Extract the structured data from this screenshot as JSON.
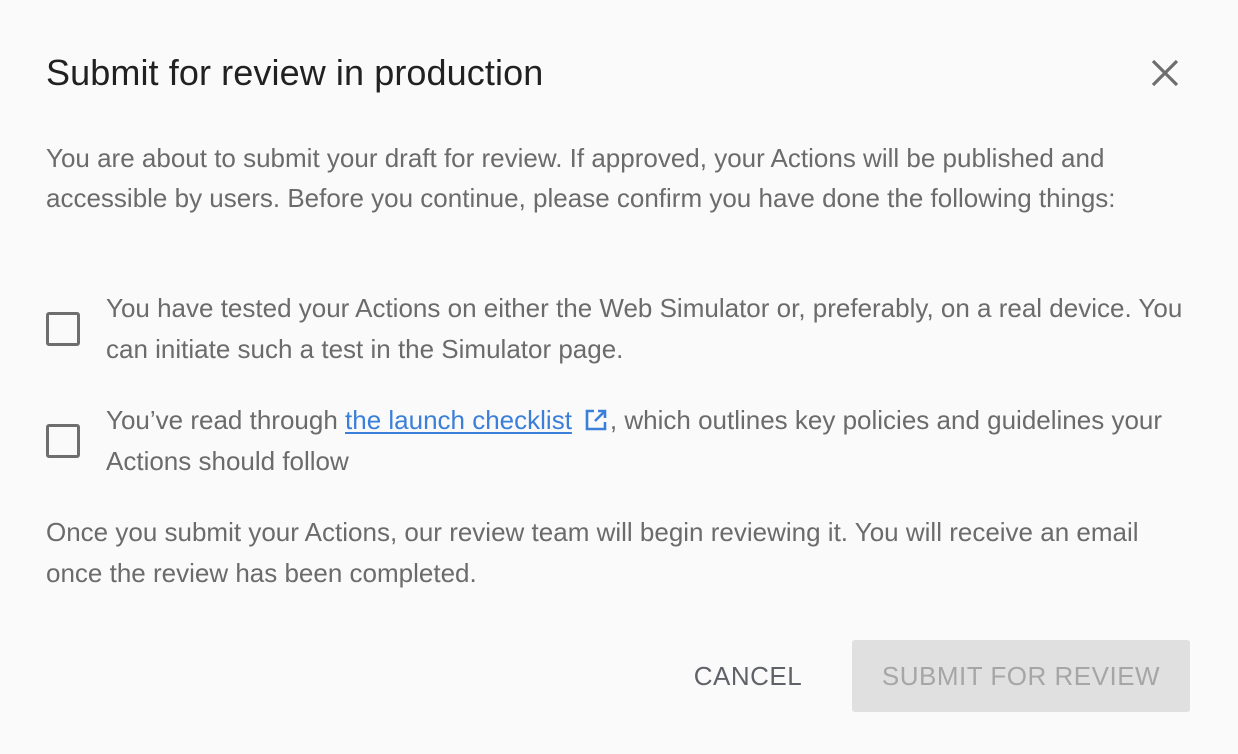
{
  "dialog": {
    "title": "Submit for review in production",
    "close_icon": "close-icon",
    "intro": "You are about to submit your draft for review. If approved, your Actions will be published and accessible by users. Before you continue, please confirm you have done the following things:",
    "checklist": [
      {
        "checked": false,
        "text": "You have tested your Actions on either the Web Simulator or, preferably, on a real device. You can initiate such a test in the Simulator page."
      },
      {
        "checked": false,
        "text_before": "You’ve read through ",
        "link_text": "the launch checklist",
        "link_icon": "external-link-icon",
        "text_after": ", which outlines key policies and guidelines your Actions should follow"
      }
    ],
    "outro": "Once you submit your Actions, our review team will begin reviewing it. You will receive an email once the review has been completed.",
    "cancel_label": "CANCEL",
    "submit_label": "SUBMIT FOR REVIEW",
    "submit_enabled": false
  },
  "colors": {
    "title_text": "#212121",
    "body_text": "#6b6b6b",
    "link": "#3b7fd9",
    "disabled_button_bg": "#e0e0e0",
    "disabled_button_text": "#a6a6a6"
  }
}
